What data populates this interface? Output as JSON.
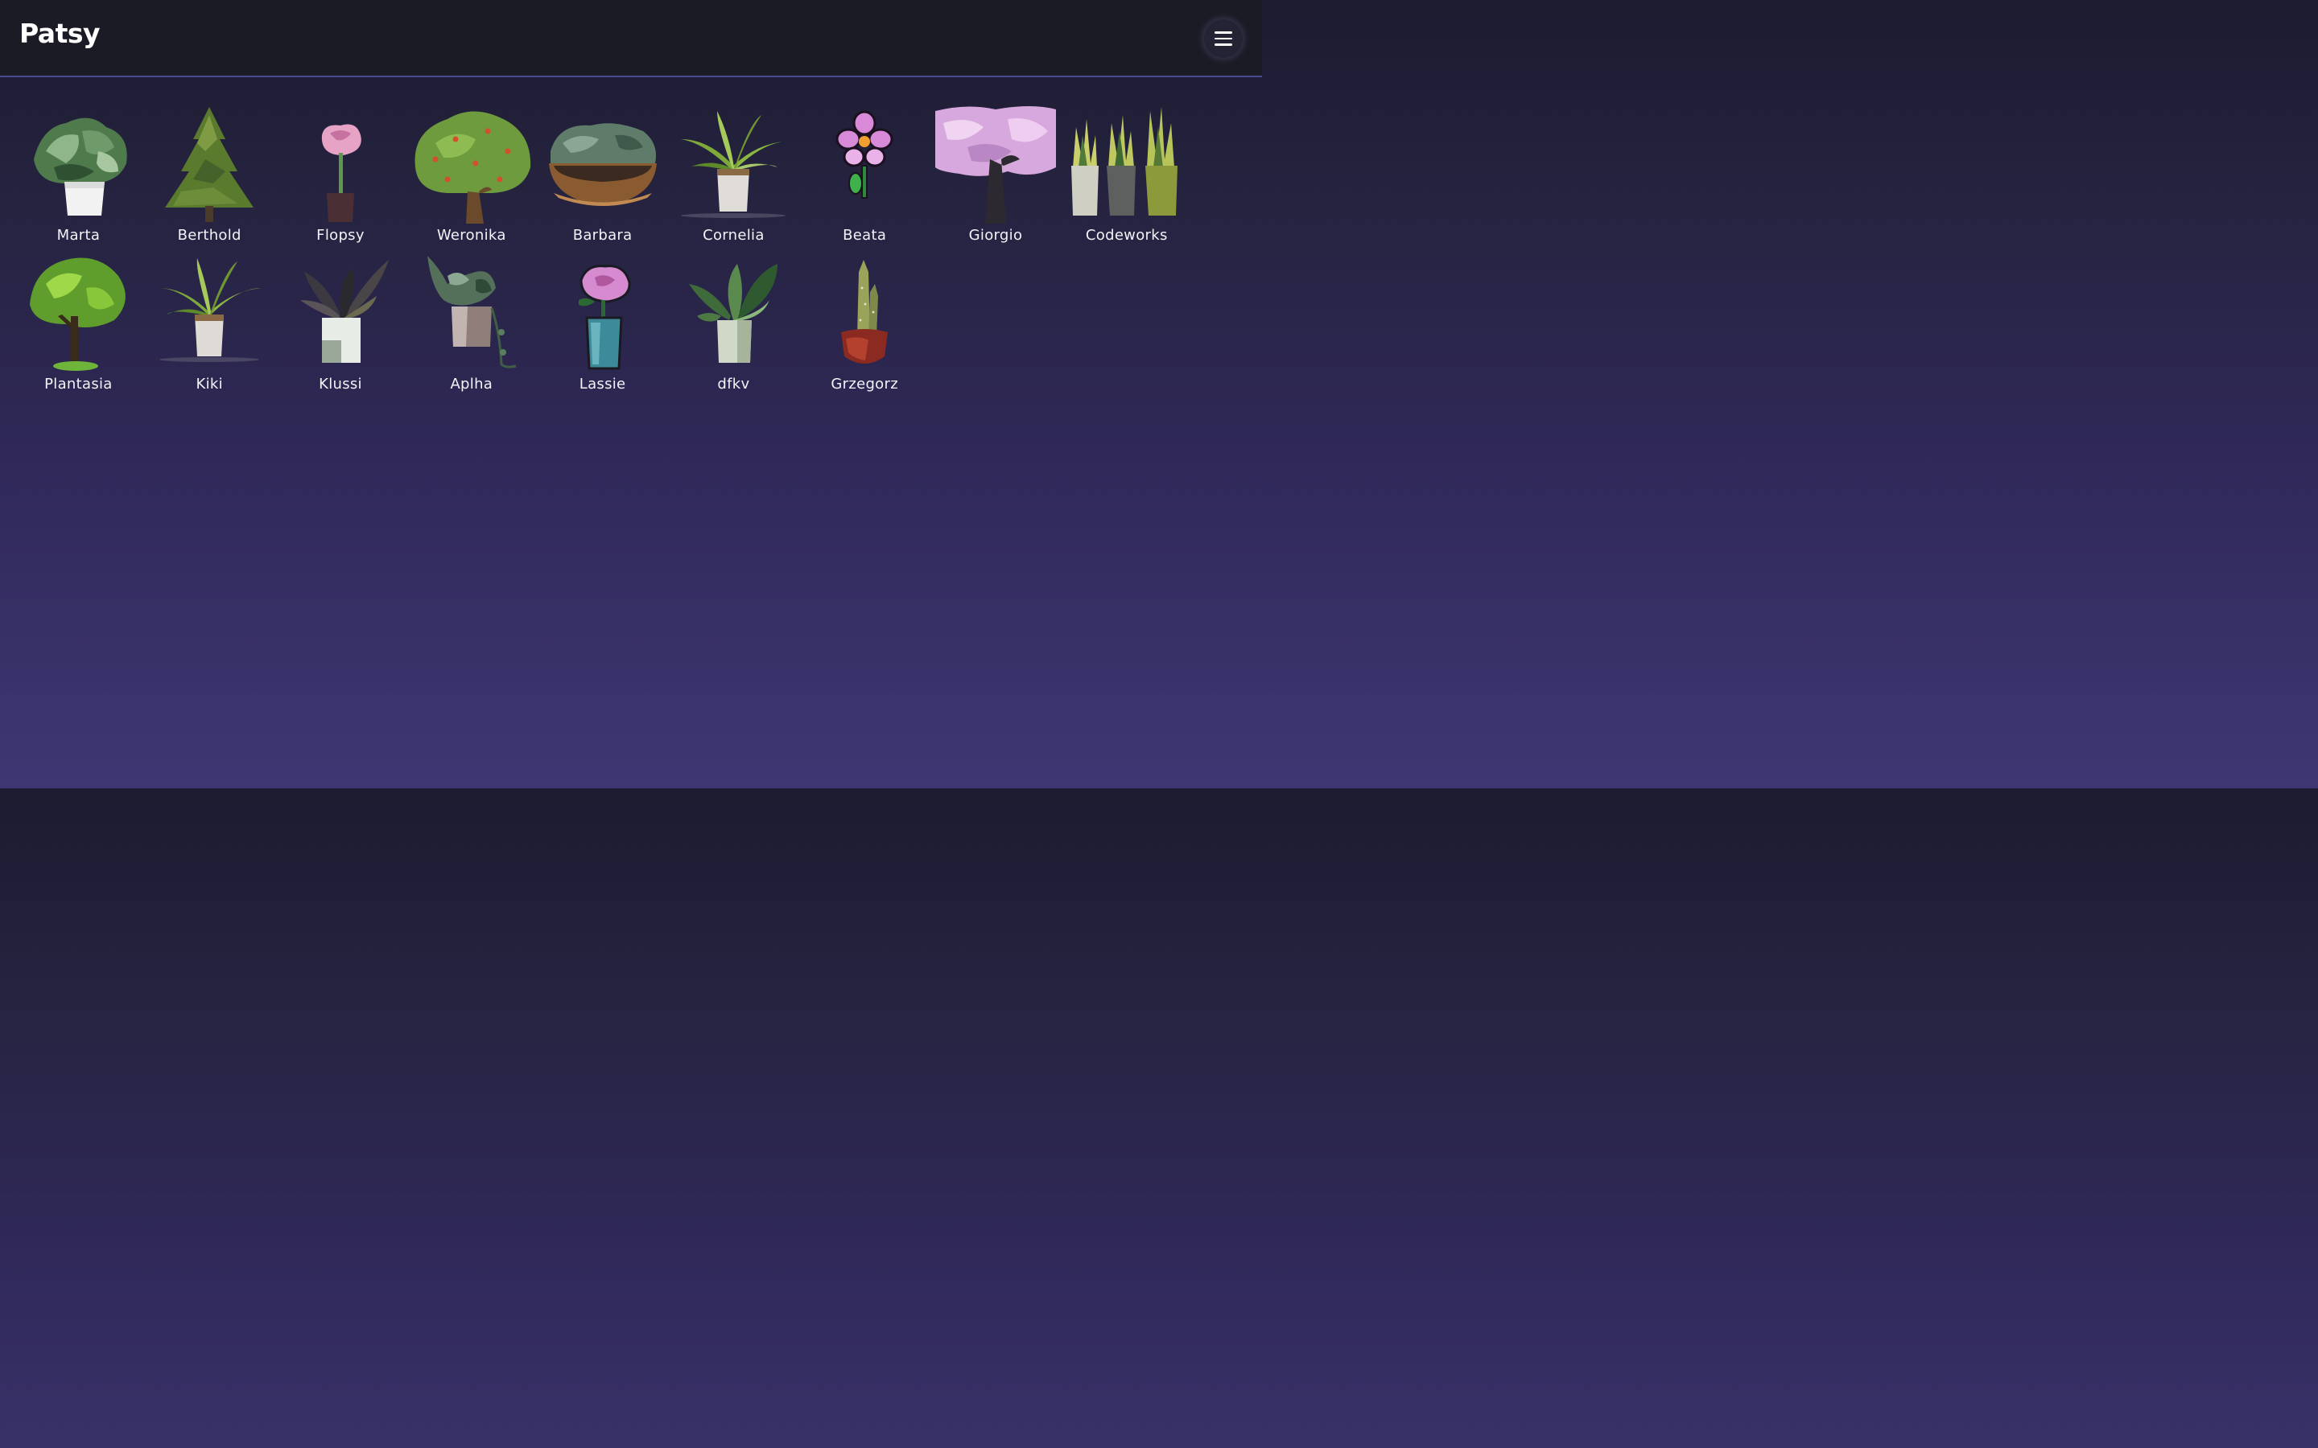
{
  "app": {
    "title": "Patsy"
  },
  "header": {
    "menu_icon": "hamburger-icon"
  },
  "colors": {
    "header_bg": "#1b1b25",
    "header_border": "#4a4a8c",
    "page_bg_top": "#1c1b30",
    "page_bg_bottom": "#3e3773",
    "label_text": "#f2f2f7"
  },
  "plants": [
    {
      "name": "Marta",
      "icon": "potted-leafy-plant-icon"
    },
    {
      "name": "Berthold",
      "icon": "pine-tree-icon"
    },
    {
      "name": "Flopsy",
      "icon": "pink-flower-pot-icon"
    },
    {
      "name": "Weronika",
      "icon": "fruit-tree-icon"
    },
    {
      "name": "Barbara",
      "icon": "bowl-planter-icon"
    },
    {
      "name": "Cornelia",
      "icon": "potted-palm-icon"
    },
    {
      "name": "Beata",
      "icon": "purple-flower-icon"
    },
    {
      "name": "Giorgio",
      "icon": "blossom-tree-icon"
    },
    {
      "name": "Codeworks",
      "icon": "snake-plants-icon"
    },
    {
      "name": "Plantasia",
      "icon": "small-tree-icon"
    },
    {
      "name": "Kiki",
      "icon": "potted-palm-icon"
    },
    {
      "name": "Klussi",
      "icon": "dark-rubber-plant-icon"
    },
    {
      "name": "Aplha",
      "icon": "trailing-ivy-icon"
    },
    {
      "name": "Lassie",
      "icon": "pink-flower-blue-pot-icon"
    },
    {
      "name": "dfkv",
      "icon": "monstera-icon"
    },
    {
      "name": "Grzegorz",
      "icon": "cactus-red-pot-icon"
    }
  ]
}
